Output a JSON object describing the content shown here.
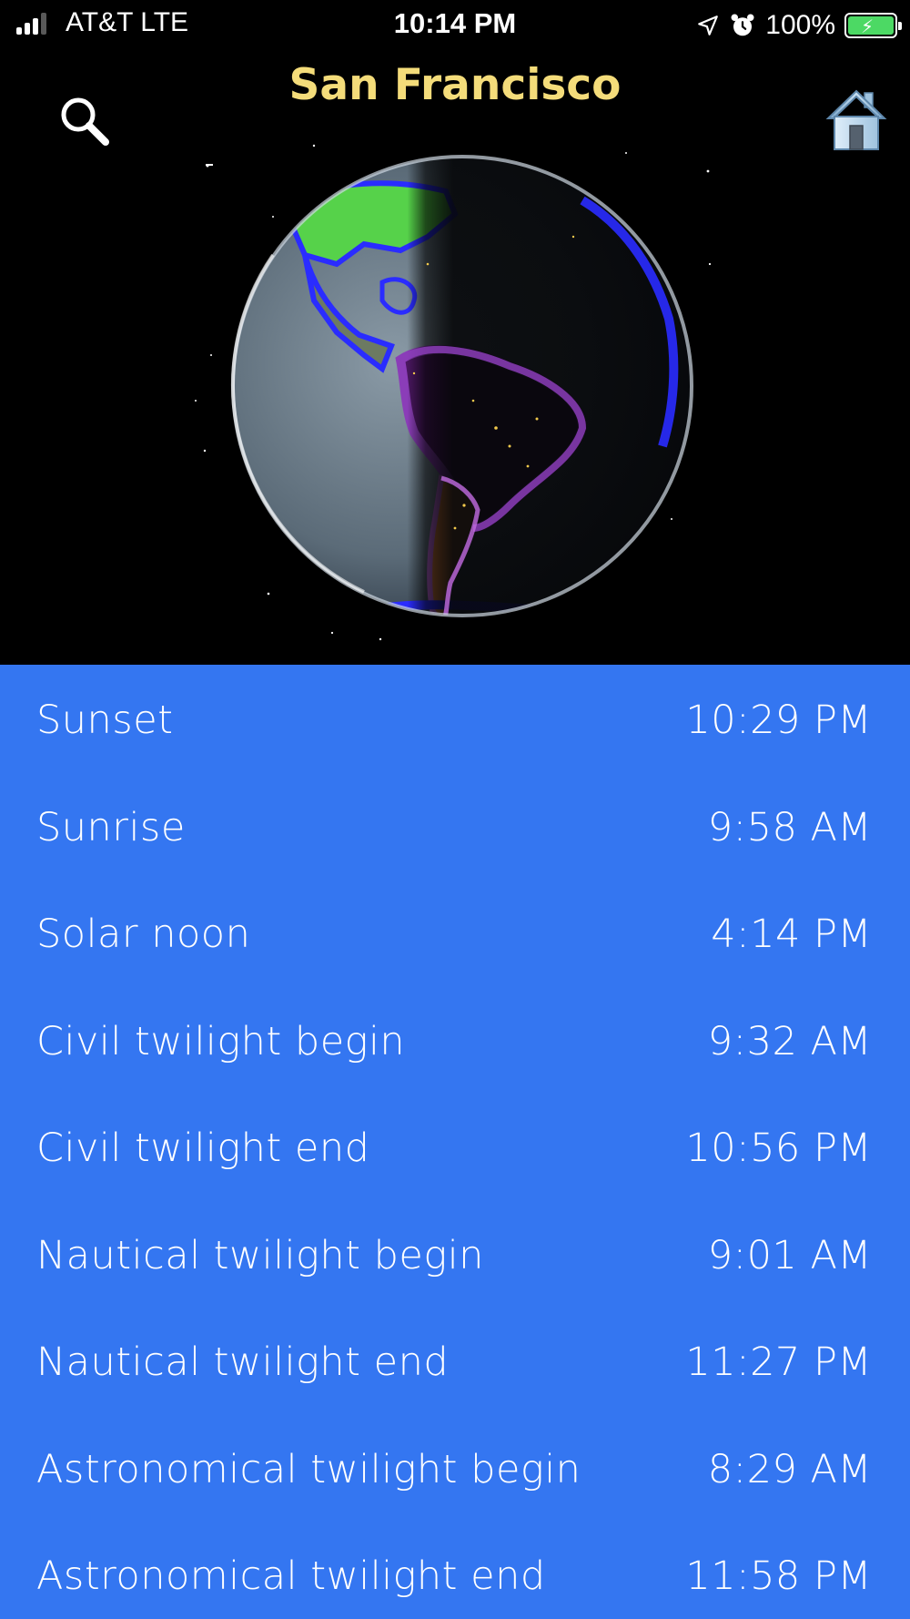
{
  "status_bar": {
    "carrier": "AT&T  LTE",
    "time": "10:14 PM",
    "battery_percent": "100%",
    "signal_bars": 3,
    "battery_level": 1.0,
    "icons": [
      "signal-icon",
      "location-arrow-icon",
      "alarm-icon",
      "battery-charging-icon"
    ]
  },
  "header": {
    "title": "San Francisco",
    "search_icon": "search-icon",
    "home_icon": "home-icon"
  },
  "colors": {
    "title": "#f4dc7a",
    "list_background": "#3476f1",
    "background": "#000000"
  },
  "sun_times": [
    {
      "label": "Sunset",
      "time": "10:29 PM"
    },
    {
      "label": "Sunrise",
      "time": "9:58 AM"
    },
    {
      "label": "Solar noon",
      "time": "4:14 PM"
    },
    {
      "label": "Civil twilight begin",
      "time": "9:32 AM"
    },
    {
      "label": "Civil twilight end",
      "time": "10:56 PM"
    },
    {
      "label": "Nautical twilight begin",
      "time": "9:01 AM"
    },
    {
      "label": "Nautical twilight end",
      "time": "11:27 PM"
    },
    {
      "label": "Astronomical twilight begin",
      "time": "8:29 AM"
    },
    {
      "label": "Astronomical twilight end",
      "time": "11:58 PM"
    }
  ]
}
